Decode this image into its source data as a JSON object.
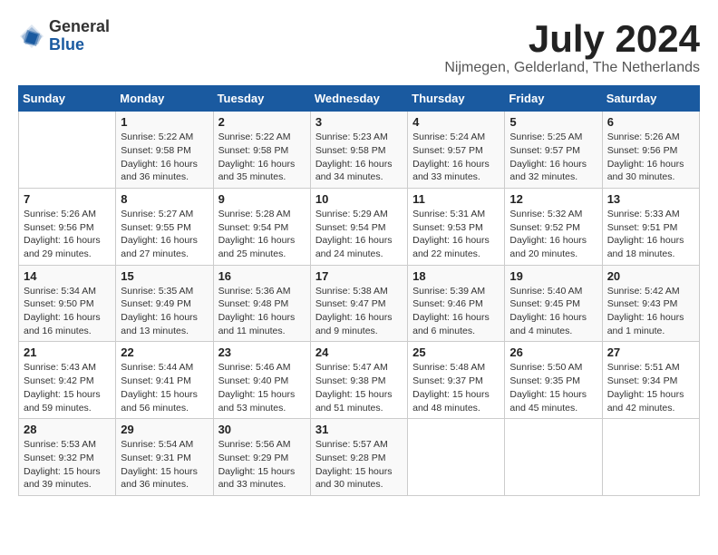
{
  "logo": {
    "general": "General",
    "blue": "Blue"
  },
  "title": "July 2024",
  "location": "Nijmegen, Gelderland, The Netherlands",
  "headers": [
    "Sunday",
    "Monday",
    "Tuesday",
    "Wednesday",
    "Thursday",
    "Friday",
    "Saturday"
  ],
  "weeks": [
    [
      {
        "day": "",
        "info": ""
      },
      {
        "day": "1",
        "info": "Sunrise: 5:22 AM\nSunset: 9:58 PM\nDaylight: 16 hours\nand 36 minutes."
      },
      {
        "day": "2",
        "info": "Sunrise: 5:22 AM\nSunset: 9:58 PM\nDaylight: 16 hours\nand 35 minutes."
      },
      {
        "day": "3",
        "info": "Sunrise: 5:23 AM\nSunset: 9:58 PM\nDaylight: 16 hours\nand 34 minutes."
      },
      {
        "day": "4",
        "info": "Sunrise: 5:24 AM\nSunset: 9:57 PM\nDaylight: 16 hours\nand 33 minutes."
      },
      {
        "day": "5",
        "info": "Sunrise: 5:25 AM\nSunset: 9:57 PM\nDaylight: 16 hours\nand 32 minutes."
      },
      {
        "day": "6",
        "info": "Sunrise: 5:26 AM\nSunset: 9:56 PM\nDaylight: 16 hours\nand 30 minutes."
      }
    ],
    [
      {
        "day": "7",
        "info": "Sunrise: 5:26 AM\nSunset: 9:56 PM\nDaylight: 16 hours\nand 29 minutes."
      },
      {
        "day": "8",
        "info": "Sunrise: 5:27 AM\nSunset: 9:55 PM\nDaylight: 16 hours\nand 27 minutes."
      },
      {
        "day": "9",
        "info": "Sunrise: 5:28 AM\nSunset: 9:54 PM\nDaylight: 16 hours\nand 25 minutes."
      },
      {
        "day": "10",
        "info": "Sunrise: 5:29 AM\nSunset: 9:54 PM\nDaylight: 16 hours\nand 24 minutes."
      },
      {
        "day": "11",
        "info": "Sunrise: 5:31 AM\nSunset: 9:53 PM\nDaylight: 16 hours\nand 22 minutes."
      },
      {
        "day": "12",
        "info": "Sunrise: 5:32 AM\nSunset: 9:52 PM\nDaylight: 16 hours\nand 20 minutes."
      },
      {
        "day": "13",
        "info": "Sunrise: 5:33 AM\nSunset: 9:51 PM\nDaylight: 16 hours\nand 18 minutes."
      }
    ],
    [
      {
        "day": "14",
        "info": "Sunrise: 5:34 AM\nSunset: 9:50 PM\nDaylight: 16 hours\nand 16 minutes."
      },
      {
        "day": "15",
        "info": "Sunrise: 5:35 AM\nSunset: 9:49 PM\nDaylight: 16 hours\nand 13 minutes."
      },
      {
        "day": "16",
        "info": "Sunrise: 5:36 AM\nSunset: 9:48 PM\nDaylight: 16 hours\nand 11 minutes."
      },
      {
        "day": "17",
        "info": "Sunrise: 5:38 AM\nSunset: 9:47 PM\nDaylight: 16 hours\nand 9 minutes."
      },
      {
        "day": "18",
        "info": "Sunrise: 5:39 AM\nSunset: 9:46 PM\nDaylight: 16 hours\nand 6 minutes."
      },
      {
        "day": "19",
        "info": "Sunrise: 5:40 AM\nSunset: 9:45 PM\nDaylight: 16 hours\nand 4 minutes."
      },
      {
        "day": "20",
        "info": "Sunrise: 5:42 AM\nSunset: 9:43 PM\nDaylight: 16 hours\nand 1 minute."
      }
    ],
    [
      {
        "day": "21",
        "info": "Sunrise: 5:43 AM\nSunset: 9:42 PM\nDaylight: 15 hours\nand 59 minutes."
      },
      {
        "day": "22",
        "info": "Sunrise: 5:44 AM\nSunset: 9:41 PM\nDaylight: 15 hours\nand 56 minutes."
      },
      {
        "day": "23",
        "info": "Sunrise: 5:46 AM\nSunset: 9:40 PM\nDaylight: 15 hours\nand 53 minutes."
      },
      {
        "day": "24",
        "info": "Sunrise: 5:47 AM\nSunset: 9:38 PM\nDaylight: 15 hours\nand 51 minutes."
      },
      {
        "day": "25",
        "info": "Sunrise: 5:48 AM\nSunset: 9:37 PM\nDaylight: 15 hours\nand 48 minutes."
      },
      {
        "day": "26",
        "info": "Sunrise: 5:50 AM\nSunset: 9:35 PM\nDaylight: 15 hours\nand 45 minutes."
      },
      {
        "day": "27",
        "info": "Sunrise: 5:51 AM\nSunset: 9:34 PM\nDaylight: 15 hours\nand 42 minutes."
      }
    ],
    [
      {
        "day": "28",
        "info": "Sunrise: 5:53 AM\nSunset: 9:32 PM\nDaylight: 15 hours\nand 39 minutes."
      },
      {
        "day": "29",
        "info": "Sunrise: 5:54 AM\nSunset: 9:31 PM\nDaylight: 15 hours\nand 36 minutes."
      },
      {
        "day": "30",
        "info": "Sunrise: 5:56 AM\nSunset: 9:29 PM\nDaylight: 15 hours\nand 33 minutes."
      },
      {
        "day": "31",
        "info": "Sunrise: 5:57 AM\nSunset: 9:28 PM\nDaylight: 15 hours\nand 30 minutes."
      },
      {
        "day": "",
        "info": ""
      },
      {
        "day": "",
        "info": ""
      },
      {
        "day": "",
        "info": ""
      }
    ]
  ]
}
